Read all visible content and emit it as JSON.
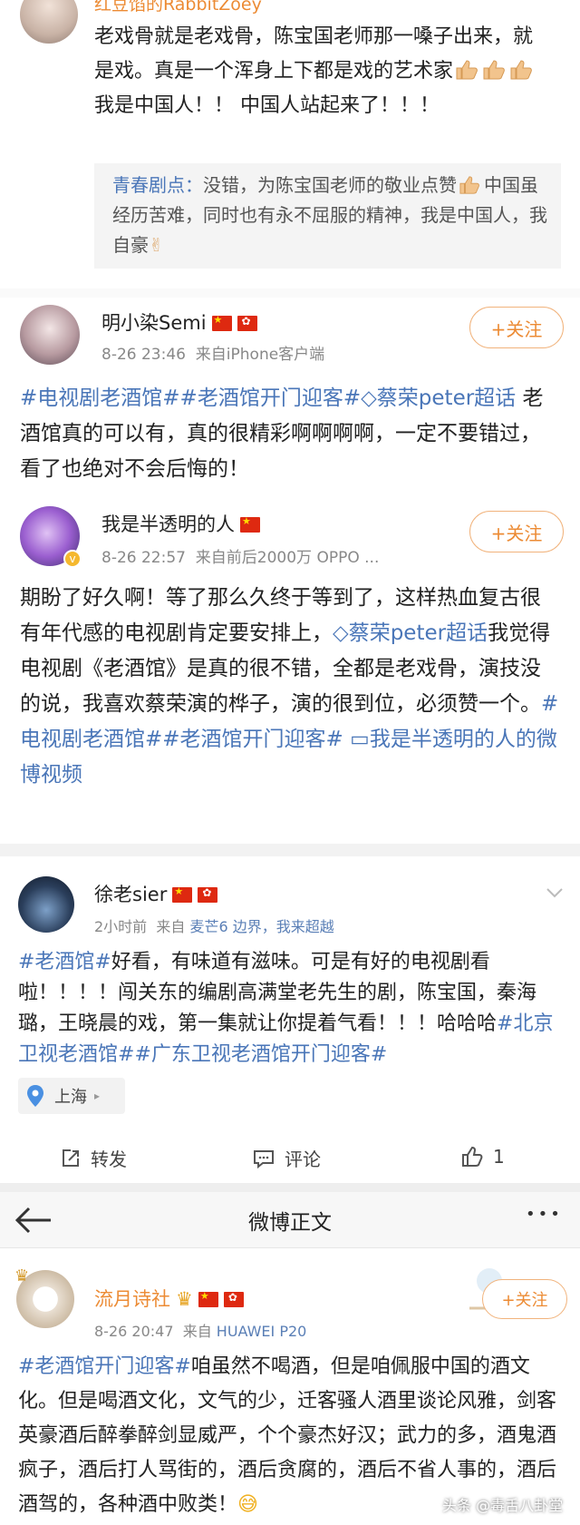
{
  "comment0": {
    "name": "红豆馅的RabbitZoey",
    "text": "老戏骨就是老戏骨，陈宝国老师那一嗓子出来，就是戏。真是一个浑身上下都是戏的艺术家",
    "text2": "我是中国人！！ 中国人站起来了！！！",
    "reply_author": "青春剧点：",
    "reply_text": "没错，为陈宝国老师的敬业点赞",
    "reply_text2": "中国虽经历苦难，同时也有永不屈服的精神，我是中国人，我自豪"
  },
  "post1": {
    "name": "明小染Semi",
    "time": "8-26 23:46",
    "source_prefix": "来自",
    "source": "iPhone客户端",
    "follow": "+关注",
    "tag1": "#电视剧老酒馆#",
    "tag2": "#老酒馆开门迎客#",
    "tag3": "蔡荣peter超话",
    "text": "老酒馆真的可以有，真的很精彩啊啊啊啊，一定不要错过，看了也绝对不会后悔的！"
  },
  "post2": {
    "name": "我是半透明的人",
    "time": "8-26 22:57",
    "source_prefix": "来自",
    "source": "前后2000万 OPPO ...",
    "follow": "+关注",
    "text1": "期盼了好久啊！等了那么久终于等到了，这样热血复古很有年代感的电视剧肯定要安排上，",
    "tag_super": "蔡荣peter超话",
    "text2": "我觉得电视剧《老酒馆》是真的很不错，全都是老戏骨，演技没的说，我喜欢蔡荣演的桦子，演的很到位，必须赞一个。",
    "tag1": "#电视剧老酒馆#",
    "tag2": "#老酒馆开门迎客#",
    "video": "我是半透明的人的微博视频"
  },
  "post3": {
    "name": "徐老sier",
    "time": "2小时前",
    "source_prefix": "来自",
    "source": "麦芒6 边界，我来超越",
    "tag1": "#老酒馆#",
    "text": "好看，有味道有滋味。可是有好的电视剧看啦！！！！闯关东的编剧高满堂老先生的剧，陈宝国，秦海璐，王晓晨的戏，第一集就让你提着气看！！！哈哈哈",
    "tag2": "#北京卫视老酒馆#",
    "tag3": "#广东卫视老酒馆开门迎客#",
    "location": "上海",
    "repost": "转发",
    "comment": "评论",
    "likes": "1"
  },
  "navbar": {
    "title": "微博正文",
    "more": "•••"
  },
  "post4": {
    "name": "流月诗社",
    "time": "8-26 20:47",
    "source_prefix": "来自",
    "source": "HUAWEI P20",
    "follow": "+关注",
    "tag1": "#老酒馆开门迎客#",
    "text": "咱虽然不喝酒，但是咱佩服中国的酒文化。但是喝酒文化，文气的少，迁客骚人酒里谈论风雅，剑客英豪酒后醉拳醉剑显威严，个个豪杰好汉；武力的多，酒鬼酒疯子，酒后打人骂街的，酒后贪腐的，酒后不省人事的，酒后酒驾的，各种酒中败类！",
    "watermark": "头条 @毒舌八卦堂"
  }
}
